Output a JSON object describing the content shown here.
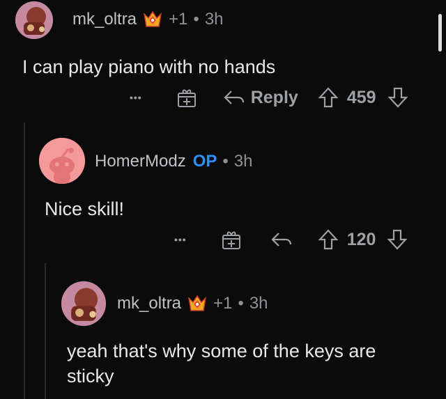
{
  "comments": [
    {
      "username": "mk_oltra",
      "flair": "+1",
      "separator": "•",
      "time": "3h",
      "text": "I can play piano with no hands",
      "more": "•••",
      "reply_label": "Reply",
      "votes": "459"
    },
    {
      "username": "HomerModz",
      "op": "OP",
      "separator": "•",
      "time": "3h",
      "text": "Nice skill!",
      "more": "•••",
      "votes": "120"
    },
    {
      "username": "mk_oltra",
      "flair": "+1",
      "separator": "•",
      "time": "3h",
      "text_line1": "yeah that's why some of the keys are",
      "text_line2": "sticky"
    }
  ],
  "colors": {
    "background": "#0b0b0b",
    "op_badge": "#2f8ff0",
    "muted": "#8e9196",
    "text": "#e8e8e8"
  },
  "icons": [
    "award-gift-icon",
    "reply-arrow-icon",
    "upvote-icon",
    "downvote-icon",
    "trophy-flair-icon",
    "snoo-avatar-icon"
  ]
}
